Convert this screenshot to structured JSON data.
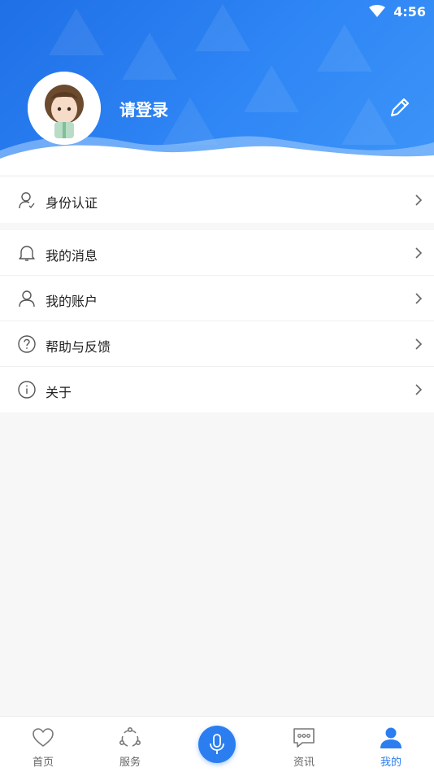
{
  "status_bar": {
    "time": "4:56"
  },
  "profile": {
    "login_text": "请登录"
  },
  "menu_top": [
    {
      "label": "身份认证",
      "icon": "id-verify-icon"
    }
  ],
  "menu_main": [
    {
      "label": "我的消息",
      "icon": "bell-icon"
    },
    {
      "label": "我的账户",
      "icon": "user-icon"
    },
    {
      "label": "帮助与反馈",
      "icon": "help-icon"
    },
    {
      "label": "关于",
      "icon": "info-icon"
    }
  ],
  "tabbar": {
    "items": [
      {
        "label": "首页",
        "icon": "heart-icon"
      },
      {
        "label": "服务",
        "icon": "service-icon"
      },
      {
        "label": "",
        "icon": "microphone-icon"
      },
      {
        "label": "资讯",
        "icon": "chat-icon"
      },
      {
        "label": "我的",
        "icon": "profile-icon",
        "active": true
      }
    ]
  },
  "colors": {
    "accent": "#2b7ef0",
    "header_start": "#1f6fe6",
    "header_end": "#3d95f8"
  }
}
